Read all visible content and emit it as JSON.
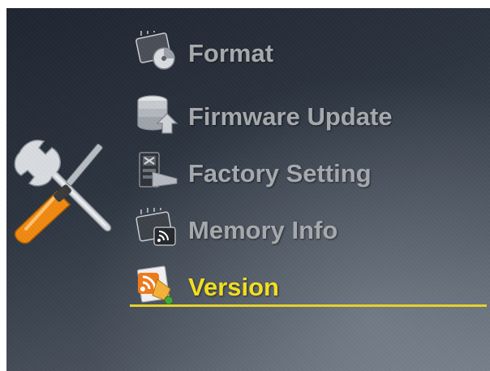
{
  "menu": {
    "items": [
      {
        "label": "Format",
        "icon": "memory-chip-icon",
        "selected": false
      },
      {
        "label": "Firmware Update",
        "icon": "database-upload-icon",
        "selected": false
      },
      {
        "label": "Factory Setting",
        "icon": "factory-reset-icon",
        "selected": false
      },
      {
        "label": "Memory Info",
        "icon": "memory-chip-wifi-icon",
        "selected": false
      },
      {
        "label": "Version",
        "icon": "rss-document-icon",
        "selected": true
      }
    ]
  },
  "header_icon": "wrench-screwdriver-icon",
  "colors": {
    "label_default": "#a6a9ad",
    "label_selected": "#f4e01e",
    "selection_underline": "#e6d22a",
    "background_dark": "#1f2530"
  }
}
